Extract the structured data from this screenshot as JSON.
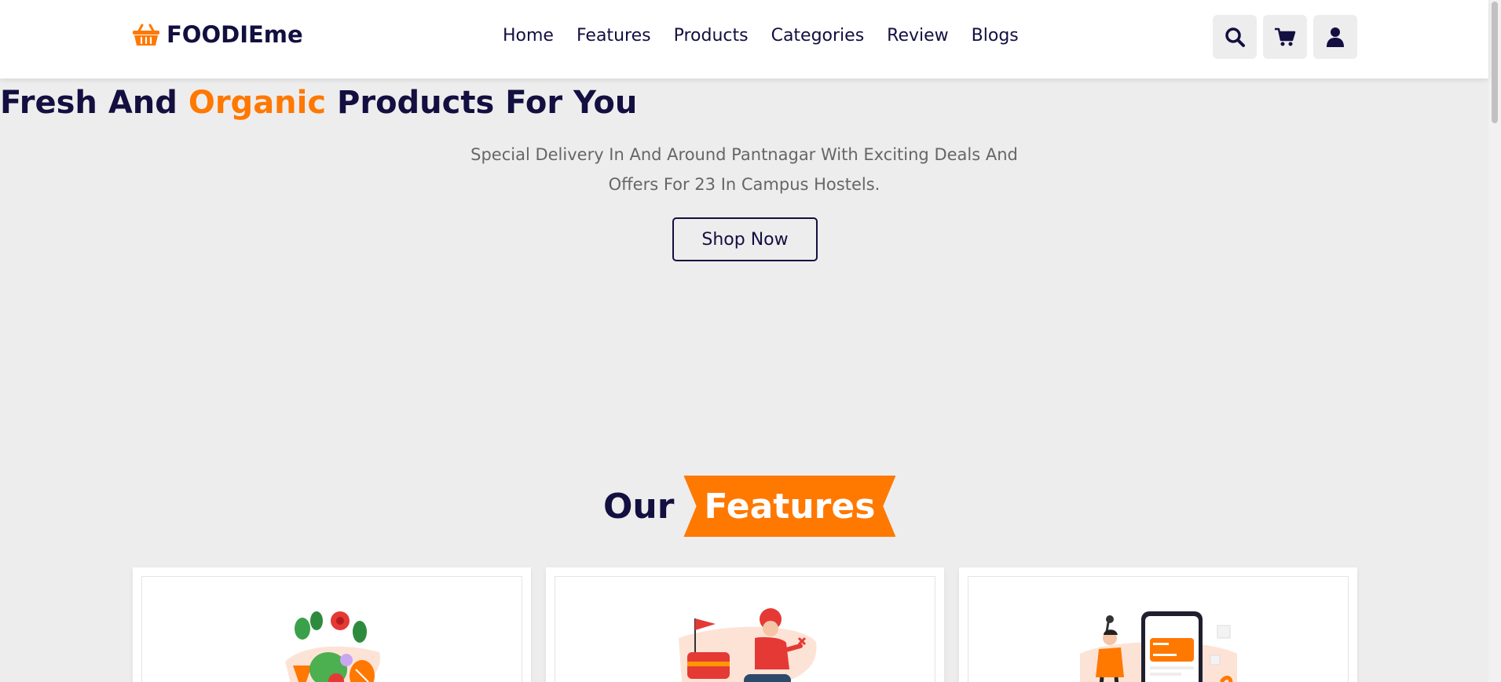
{
  "header": {
    "logo_text": "FOODIEme",
    "logo_icon": "basket-icon",
    "nav": [
      "Home",
      "Features",
      "Products",
      "Categories",
      "Review",
      "Blogs"
    ],
    "icons": [
      "search-icon",
      "cart-icon",
      "user-icon"
    ]
  },
  "hero": {
    "title_part1": "Fresh And ",
    "title_accent": "Organic",
    "title_part2": " Products For You",
    "subtitle": "Special Delivery In And Around Pantnagar With Exciting Deals And Offers For 23 In Campus Hostels.",
    "button_label": "Shop Now"
  },
  "features": {
    "heading_plain": "Our",
    "heading_highlight": "Features",
    "cards": [
      {
        "image": "fresh-vegetables-illustration"
      },
      {
        "image": "delivery-scooter-illustration"
      },
      {
        "image": "mobile-payment-illustration"
      }
    ]
  },
  "colors": {
    "primary": "#130f40",
    "accent": "#ff7800",
    "background": "#ededed",
    "card": "#ffffff"
  }
}
